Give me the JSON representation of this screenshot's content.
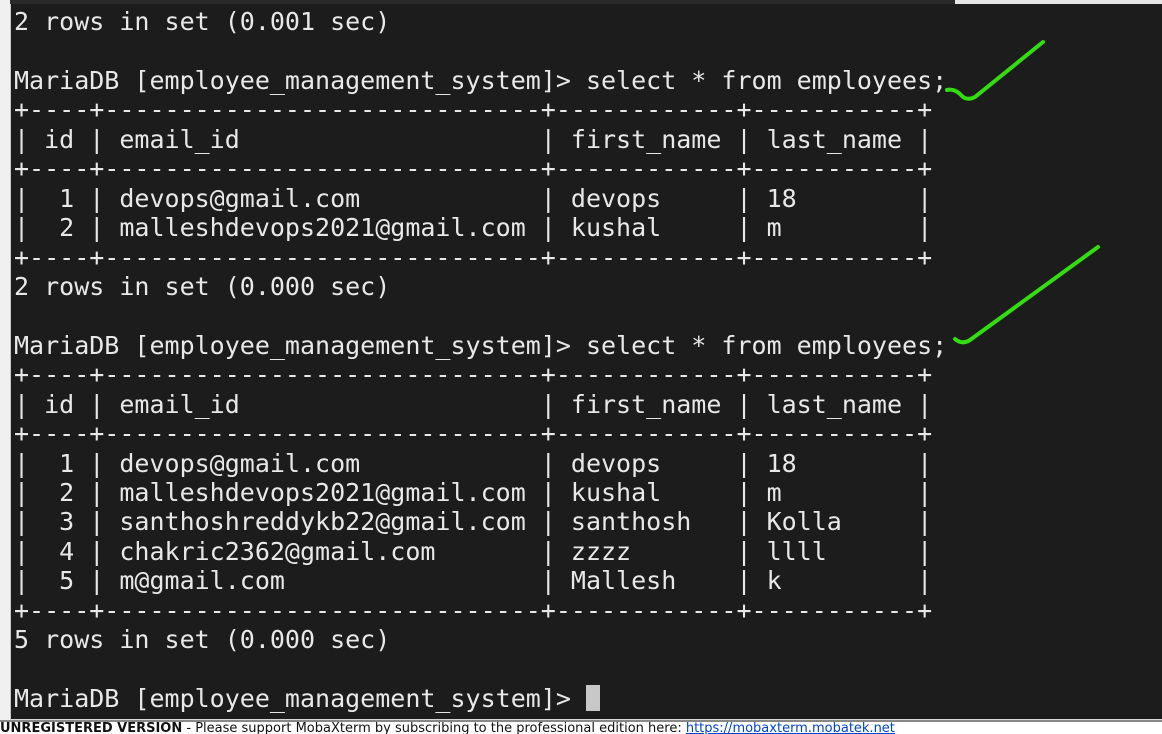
{
  "terminal": {
    "prompt": "MariaDB [employee_management_system]> ",
    "lines_before": [
      "2 rows in set (0.001 sec)",
      ""
    ],
    "queries": [
      {
        "command": "select * from employees;",
        "columns": [
          "id",
          "email_id",
          "first_name",
          "last_name"
        ],
        "rows": [
          [
            "1",
            "devops@gmail.com",
            "devops",
            "18"
          ],
          [
            "2",
            "malleshdevops2021@gmail.com",
            "kushal",
            "m"
          ]
        ],
        "result": "2 rows in set (0.000 sec)"
      },
      {
        "command": "select * from employees;",
        "columns": [
          "id",
          "email_id",
          "first_name",
          "last_name"
        ],
        "rows": [
          [
            "1",
            "devops@gmail.com",
            "devops",
            "18"
          ],
          [
            "2",
            "malleshdevops2021@gmail.com",
            "kushal",
            "m"
          ],
          [
            "3",
            "santhoshreddykb22@gmail.com",
            "santhosh",
            "Kolla"
          ],
          [
            "4",
            "chakric2362@gmail.com",
            "zzzz",
            "llll"
          ],
          [
            "5",
            "m@gmail.com",
            "Mallesh",
            "k"
          ]
        ],
        "result": "5 rows in set (0.000 sec)"
      }
    ]
  },
  "annotation_color": "#33dd11",
  "banner": {
    "label": "UNREGISTERED VERSION",
    "text": " -  Please support MobaXterm by subscribing to the professional edition here: ",
    "link": "https://mobaxterm.mobatek.net"
  }
}
